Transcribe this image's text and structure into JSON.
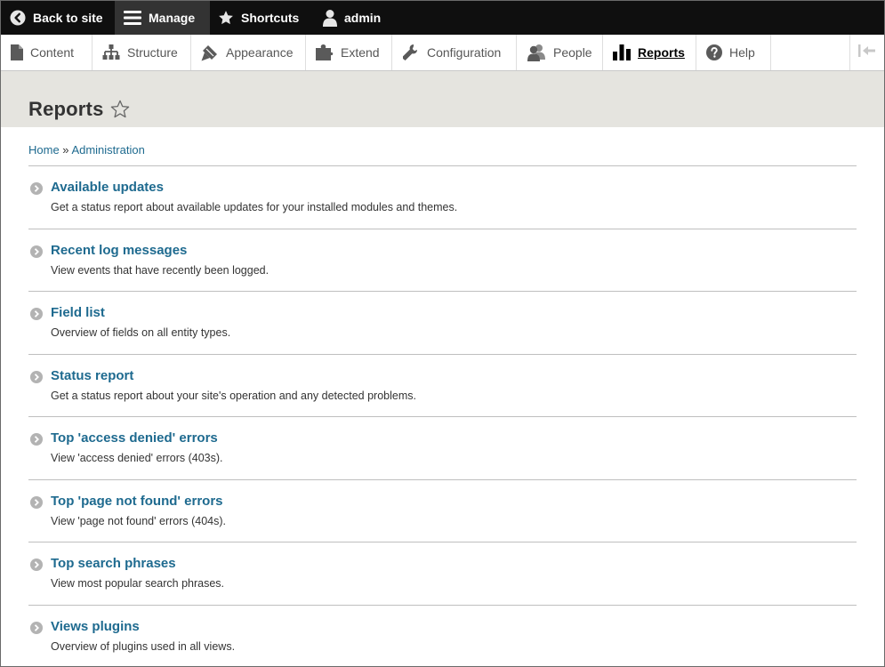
{
  "toolbar": {
    "back_label": "Back to site",
    "manage_label": "Manage",
    "shortcuts_label": "Shortcuts",
    "user_label": "admin"
  },
  "tray": {
    "items": [
      {
        "label": "Content",
        "icon": "file-icon"
      },
      {
        "label": "Structure",
        "icon": "sitemap-icon"
      },
      {
        "label": "Appearance",
        "icon": "paintbrush-icon"
      },
      {
        "label": "Extend",
        "icon": "puzzle-icon"
      },
      {
        "label": "Configuration",
        "icon": "wrench-icon"
      },
      {
        "label": "People",
        "icon": "people-icon"
      },
      {
        "label": "Reports",
        "icon": "bar-chart-icon",
        "active": true
      },
      {
        "label": "Help",
        "icon": "help-icon"
      }
    ]
  },
  "page": {
    "title": "Reports"
  },
  "breadcrumb": {
    "home": "Home",
    "separator": " » ",
    "admin": "Administration"
  },
  "admin_list": [
    {
      "title": "Available updates",
      "description": "Get a status report about available updates for your installed modules and themes."
    },
    {
      "title": "Recent log messages",
      "description": "View events that have recently been logged."
    },
    {
      "title": "Field list",
      "description": "Overview of fields on all entity types."
    },
    {
      "title": "Status report",
      "description": "Get a status report about your site's operation and any detected problems."
    },
    {
      "title": "Top 'access denied' errors",
      "description": "View 'access denied' errors (403s)."
    },
    {
      "title": "Top 'page not found' errors",
      "description": "View 'page not found' errors (404s)."
    },
    {
      "title": "Top search phrases",
      "description": "View most popular search phrases."
    },
    {
      "title": "Views plugins",
      "description": "Overview of plugins used in all views."
    }
  ],
  "colors": {
    "toolbar_bg": "#0f0f0f",
    "manage_bg": "#333333",
    "header_bg": "#e5e4df",
    "link": "#1e6a8f"
  }
}
